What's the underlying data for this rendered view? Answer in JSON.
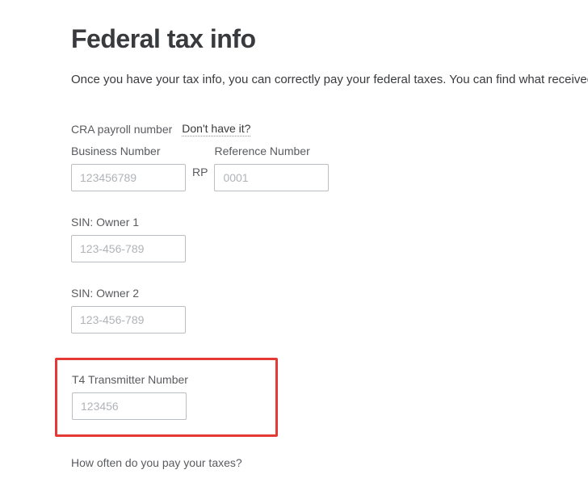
{
  "header": {
    "title": "Federal tax info",
    "description": "Once you have your tax info, you can correctly pay your federal taxes. You can find what received from the CRA."
  },
  "cra_row": {
    "label": "CRA payroll number",
    "link": "Don't have it?"
  },
  "business_number": {
    "label": "Business Number",
    "placeholder": "123456789",
    "value": ""
  },
  "rp_separator": "RP",
  "reference_number": {
    "label": "Reference Number",
    "placeholder": "0001",
    "value": ""
  },
  "sin_owner1": {
    "label": "SIN: Owner 1",
    "placeholder": "123-456-789",
    "value": ""
  },
  "sin_owner2": {
    "label": "SIN: Owner 2",
    "placeholder": "123-456-789",
    "value": ""
  },
  "t4_transmitter": {
    "label": "T4 Transmitter Number",
    "placeholder": "123456",
    "value": ""
  },
  "frequency_question": "How often do you pay your taxes?"
}
